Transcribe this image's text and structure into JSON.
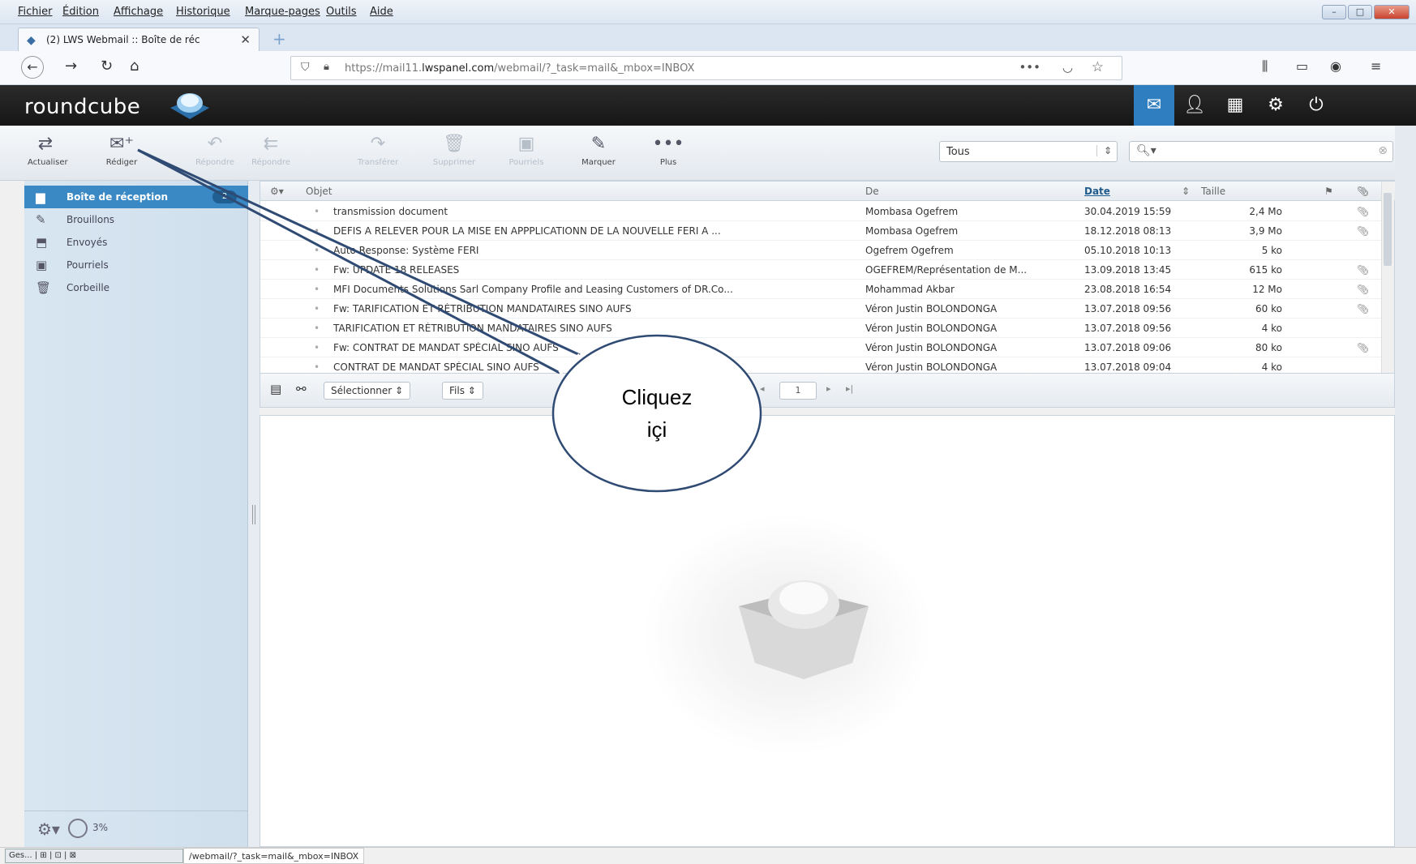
{
  "menubar": {
    "items": [
      "Fichier",
      "Édition",
      "Affichage",
      "Historique",
      "Marque-pages",
      "Outils",
      "Aide"
    ]
  },
  "browser": {
    "tab_title": "(2) LWS Webmail :: Boîte de réc",
    "url_prefix": "https://mail11.",
    "url_domain": "lwspanel.com",
    "url_path": "/webmail/?_task=mail&_mbox=INBOX"
  },
  "app": {
    "logo": "roundcube"
  },
  "toolbar": {
    "buttons": [
      "Actualiser",
      "Rédiger",
      "Répondre",
      "Répondre",
      "Transférer",
      "Supprimer",
      "Pourriels",
      "Marquer",
      "Plus"
    ],
    "filter_value": "Tous"
  },
  "folders": [
    {
      "label": "Boîte de réception",
      "badge": "2"
    },
    {
      "label": "Brouillons"
    },
    {
      "label": "Envoyés"
    },
    {
      "label": "Pourriels"
    },
    {
      "label": "Corbeille"
    }
  ],
  "quota": "3%",
  "list_headers": {
    "subject": "Objet",
    "from": "De",
    "date": "Date",
    "size": "Taille"
  },
  "messages": [
    {
      "subject": "transmission document",
      "from": "Mombasa Ogefrem",
      "date": "30.04.2019 15:59",
      "size": "2,4 Mo",
      "attach": true
    },
    {
      "subject": "DEFIS A RELEVER POUR LA MISE EN APPPLICATIONN DE LA NOUVELLE FERI A ...",
      "from": "Mombasa Ogefrem",
      "date": "18.12.2018 08:13",
      "size": "3,9 Mo",
      "attach": true
    },
    {
      "subject": "Auto Response: Système FERI",
      "from": "Ogefrem Ogefrem",
      "date": "05.10.2018 10:13",
      "size": "5 ko",
      "attach": false
    },
    {
      "subject": "Fw: UPDATE 18 RELEASES",
      "from": "OGEFREM/Représentation de M...",
      "date": "13.09.2018 13:45",
      "size": "615 ko",
      "attach": true
    },
    {
      "subject": "MFI Documents Solutions Sarl Company Profile and Leasing Customers of DR.Co...",
      "from": "Mohammad Akbar",
      "date": "23.08.2018 16:54",
      "size": "12 Mo",
      "attach": true
    },
    {
      "subject": "Fw: TARIFICATION ET RÉTRIBUTION MANDATAIRES SINO AUFS",
      "from": "Véron Justin BOLONDONGA",
      "date": "13.07.2018 09:56",
      "size": "60 ko",
      "attach": true
    },
    {
      "subject": "TARIFICATION ET RÉTRIBUTION MANDATAIRES SINO AUFS",
      "from": "Véron Justin BOLONDONGA",
      "date": "13.07.2018 09:56",
      "size": "4 ko",
      "attach": false
    },
    {
      "subject": "Fw: CONTRAT DE MANDAT SPÉCIAL SINO AUFS",
      "from": "Véron Justin BOLONDONGA",
      "date": "13.07.2018 09:06",
      "size": "80 ko",
      "attach": true
    },
    {
      "subject": "CONTRAT DE MANDAT SPÉCIAL SINO AUFS",
      "from": "Véron Justin BOLONDONGA",
      "date": "13.07.2018 09:04",
      "size": "4 ko",
      "attach": false
    }
  ],
  "list_footer": {
    "select_label": "Sélectionner",
    "threads_label": "Fils",
    "page": "1"
  },
  "statusbar": {
    "task": "Ges...",
    "url": "/webmail/?_task=mail&_mbox=INBOX"
  },
  "annotation": {
    "line1": "Cliquez",
    "line2": "içi"
  }
}
